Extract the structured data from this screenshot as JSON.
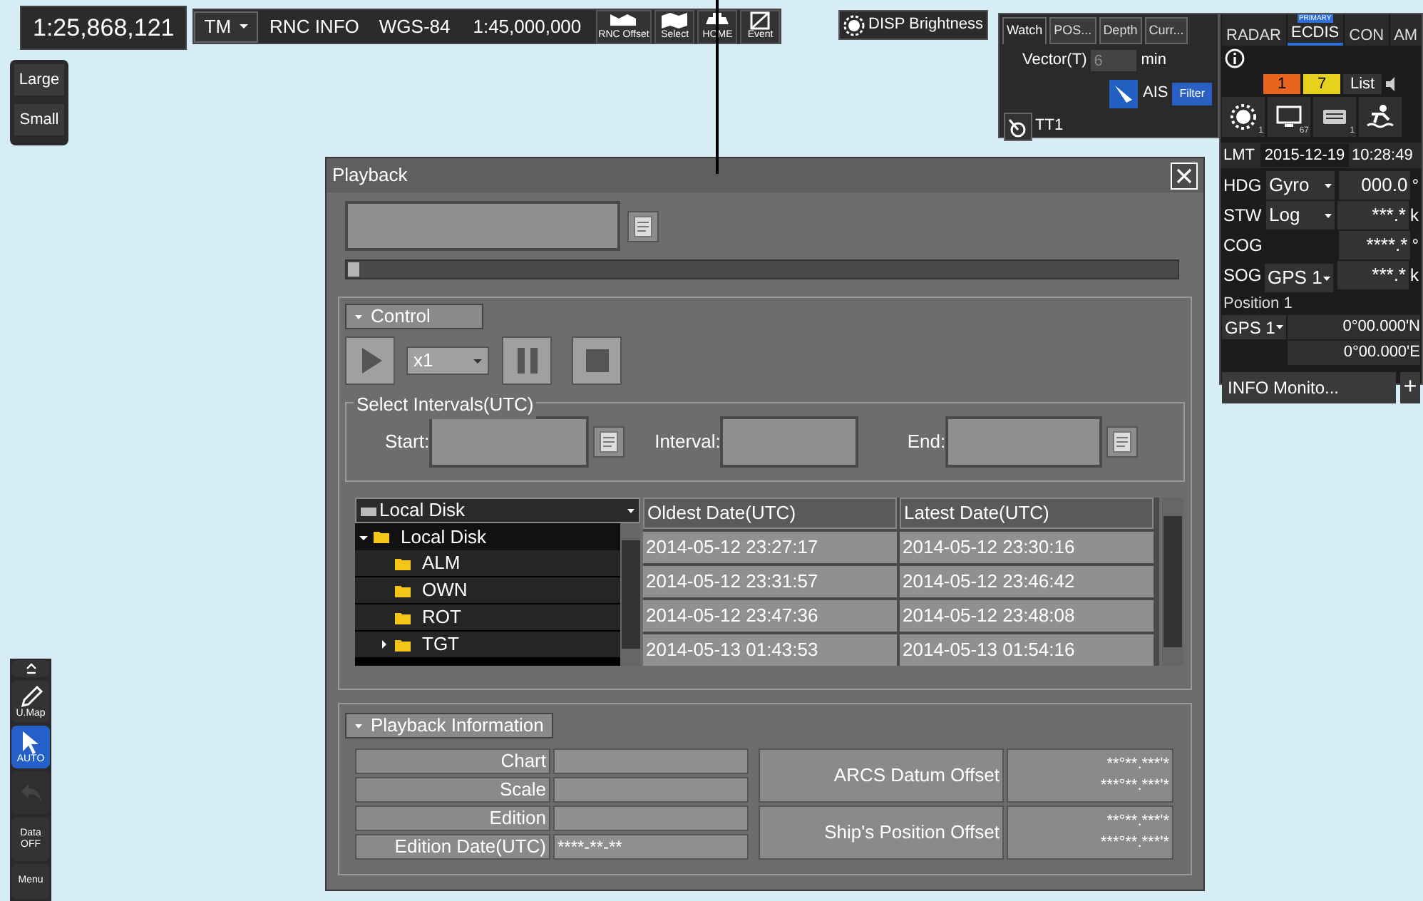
{
  "scale_display": "1:25,868,121",
  "top_bar": {
    "mode": "TM",
    "chart_info": "RNC INFO",
    "datum": "WGS-84",
    "chart_scale": "1:45,000,000",
    "tools": [
      {
        "kind": "offset",
        "label": "RNC Offset"
      },
      {
        "kind": "select",
        "label": "Select"
      },
      {
        "kind": "home",
        "label": "HOME"
      },
      {
        "kind": "event",
        "label": "Event"
      }
    ]
  },
  "disp_brightness": "DISP Brightness",
  "watch_panel": {
    "tabs": [
      {
        "label": "Watch",
        "selected": true
      },
      {
        "label": "POS...",
        "selected": false
      },
      {
        "label": "Depth",
        "selected": false
      },
      {
        "label": "Curr...",
        "selected": false
      }
    ],
    "vector_label": "Vector(T)",
    "vector_value": "6",
    "vector_unit": "min",
    "ais_label": "AIS",
    "filter": "Filter",
    "tt_label": "TT1"
  },
  "mode_panel": {
    "tabs": [
      {
        "label": "RADAR",
        "selected": false
      },
      {
        "label": "ECDIS",
        "selected": true,
        "badge": "PRIMARY"
      },
      {
        "label": "CON",
        "selected": false
      },
      {
        "label": "AM",
        "selected": false
      }
    ],
    "alarms": [
      {
        "count": "1",
        "color": "#e8641e"
      },
      {
        "count": "7",
        "color": "#e6d11c"
      }
    ],
    "list_button": "List",
    "status_icons": [
      {
        "kind": "brightness",
        "count": "1"
      },
      {
        "kind": "monitor",
        "count": "67"
      },
      {
        "kind": "keyboard",
        "count": "1"
      },
      {
        "kind": "mob"
      }
    ],
    "time_zone": "LMT",
    "date": "2015-12-19",
    "time": "10:28:49",
    "hdg": {
      "label": "HDG",
      "source": "Gyro",
      "value": "000.0",
      "unit": "°"
    },
    "stw": {
      "label": "STW",
      "source": "Log",
      "value": "***.*",
      "unit": "k"
    },
    "cog": {
      "label": "COG",
      "value": "****.*",
      "unit": "°"
    },
    "sog": {
      "label": "SOG",
      "value": "***.*",
      "unit": "k"
    },
    "cog_sog_source": "GPS 1",
    "position_label": "Position 1",
    "position_source": "GPS 1",
    "latitude": "0°00.000'N",
    "longitude": "0°00.000'E",
    "info_monitor": "INFO Monito...",
    "add_button": "+"
  },
  "size_buttons": [
    "Large",
    "Small"
  ],
  "toolbar": [
    {
      "kind": "collapse",
      "selected": false,
      "disabled": false
    },
    {
      "kind": "pencil",
      "label": "U.Map",
      "selected": false,
      "disabled": false
    },
    {
      "kind": "cursor",
      "label": "AUTO",
      "selected": true,
      "disabled": false
    },
    {
      "kind": "undo",
      "selected": false,
      "disabled": true
    },
    {
      "kind": "text",
      "label": "Data OFF",
      "selected": false,
      "disabled": false
    },
    {
      "kind": "menu",
      "label": "Menu",
      "selected": false,
      "disabled": false
    }
  ],
  "playback": {
    "title": "Playback",
    "slider": {
      "level": 0
    },
    "control": {
      "header": "Control",
      "speed": "x1"
    },
    "intervals": {
      "legend": "Select Intervals(UTC)",
      "start": "Start:",
      "interval": "Interval:",
      "end": "End:"
    },
    "tree": {
      "header": "Local Disk",
      "root": {
        "label": "Local Disk",
        "expanded": true,
        "children": [
          {
            "label": "ALM"
          },
          {
            "label": "OWN"
          },
          {
            "label": "ROT"
          },
          {
            "label": "TGT",
            "expanded": false
          }
        ]
      }
    },
    "table": {
      "columns": [
        "Oldest Date(UTC)",
        "Latest Date(UTC)"
      ],
      "rows": [
        [
          "2014-05-12 23:27:17",
          "2014-05-12 23:30:16"
        ],
        [
          "2014-05-12 23:31:57",
          "2014-05-12 23:46:42"
        ],
        [
          "2014-05-12 23:47:36",
          "2014-05-12 23:48:08"
        ],
        [
          "2014-05-13 01:43:53",
          "2014-05-13 01:54:16"
        ]
      ]
    },
    "info": {
      "header": "Playback Information",
      "fields": [
        {
          "label": "Chart"
        },
        {
          "label": "Scale"
        },
        {
          "label": "Edition"
        },
        {
          "label": "Edition Date(UTC)",
          "value": "****-**-**"
        }
      ],
      "offsets": [
        {
          "label": "ARCS Datum Offset",
          "lat": "**°**.***'*",
          "lon": "***°**.***'*"
        },
        {
          "label": "Ship's Position Offset",
          "lat": "**°**.***'*",
          "lon": "***°**.***'*"
        }
      ]
    }
  }
}
